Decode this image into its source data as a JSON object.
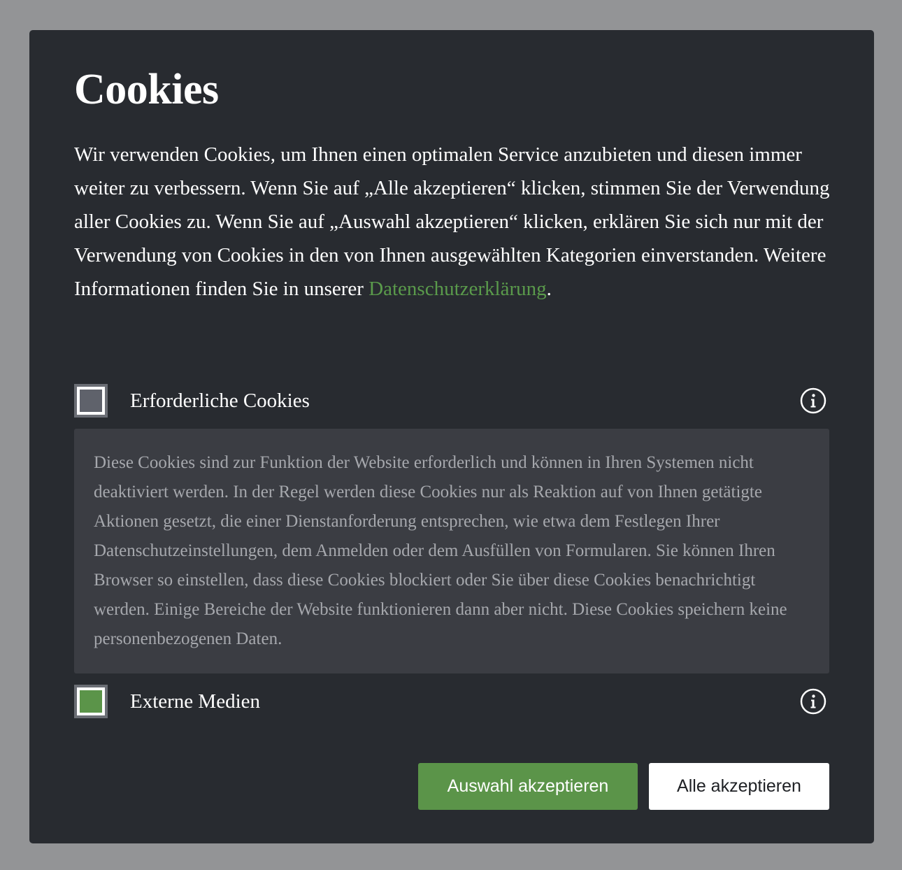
{
  "dialog": {
    "title": "Cookies",
    "intro_text": "Wir verwenden Cookies, um Ihnen einen optimalen Service anzubieten und diesen immer weiter zu verbessern. Wenn Sie auf „Alle akzeptieren“ klicken, stimmen Sie der Verwendung aller Cookies zu. Wenn Sie auf „Auswahl akzeptieren“ klicken, erklären Sie sich nur mit der Verwendung von Cookies in den von Ihnen ausgewählten Kategorien einverstanden. Weitere Informationen finden Sie in unserer ",
    "privacy_link": "Datenschutzerklärung",
    "intro_end": "."
  },
  "categories": [
    {
      "label": "Erforderliche Cookies",
      "checked": true,
      "disabled": true,
      "expanded": true,
      "info_icon": "info-circle-icon",
      "description": "Diese Cookies sind zur Funktion der Website erforderlich und können in Ihren Systemen nicht deaktiviert werden. In der Regel werden diese Cookies nur als Reaktion auf von Ihnen getätigte Aktionen gesetzt, die einer Dienstanforderung entsprechen, wie etwa dem Festlegen Ihrer Datenschutzeinstellungen, dem Anmelden oder dem Ausfüllen von Formularen. Sie können Ihren Browser so einstellen, dass diese Cookies blockiert oder Sie über diese Cookies benachrichtigt werden. Einige Bereiche der Website funktionieren dann aber nicht. Diese Cookies speichern keine personenbezogenen Daten."
    },
    {
      "label": "Externe Medien",
      "checked": true,
      "disabled": false,
      "expanded": false,
      "info_icon": "info-circle-icon"
    }
  ],
  "buttons": {
    "accept_selection": "Auswahl akzeptieren",
    "accept_all": "Alle akzeptieren"
  },
  "colors": {
    "backdrop": "#939496",
    "dialog_bg": "#282b30",
    "accent_green": "#5b9449",
    "link_green": "#5a9a4b",
    "description_bg": "#3b3d43"
  }
}
